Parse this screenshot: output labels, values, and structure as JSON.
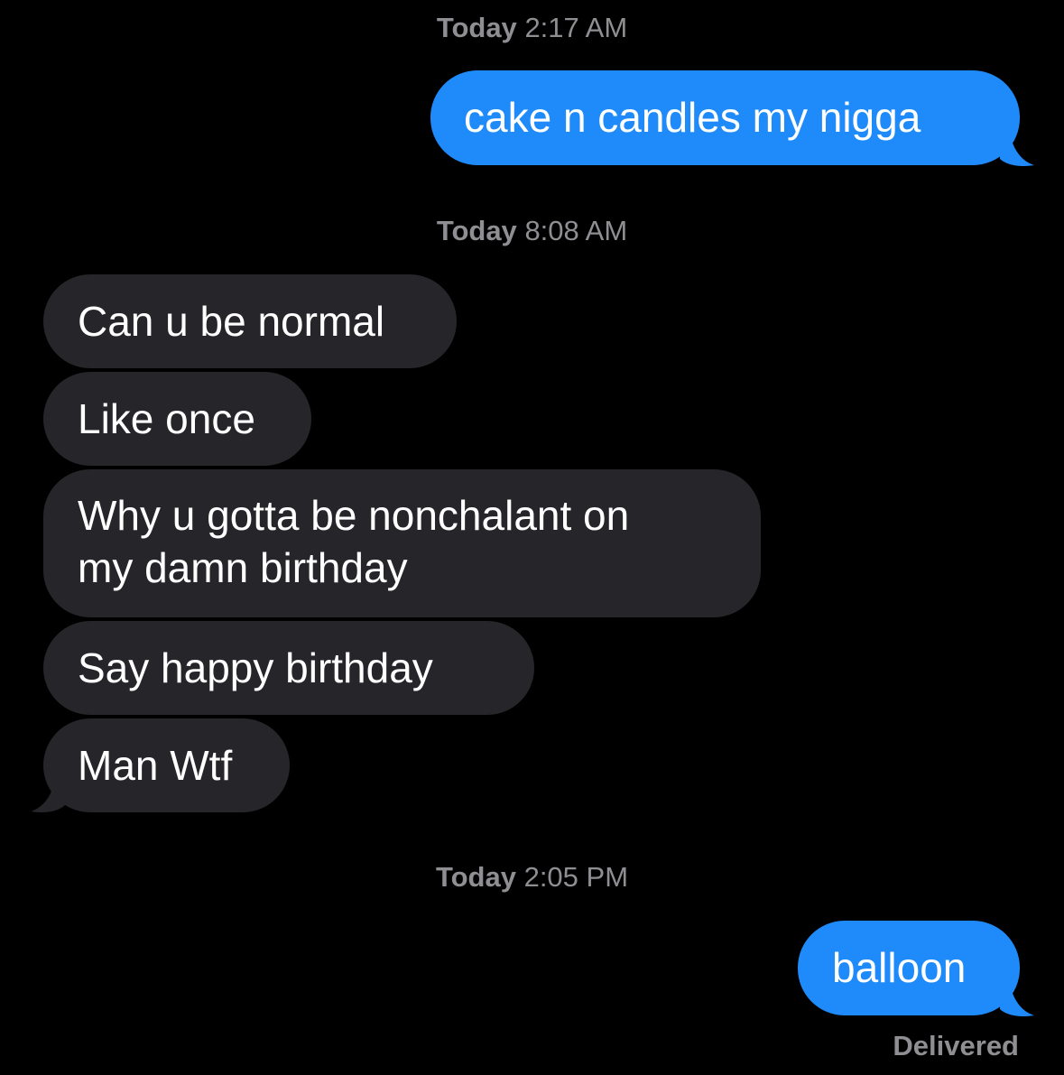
{
  "conversation": {
    "timestamps": [
      {
        "day": "Today",
        "time": "2:17 AM"
      },
      {
        "day": "Today",
        "time": "8:08 AM"
      },
      {
        "day": "Today",
        "time": "2:05 PM"
      }
    ],
    "messages": [
      {
        "direction": "outgoing",
        "text": "cake n candles my nigga"
      },
      {
        "direction": "incoming",
        "text": "Can u be normal"
      },
      {
        "direction": "incoming",
        "text": "Like once"
      },
      {
        "direction": "incoming",
        "lines": [
          "Why u gotta be nonchalant on",
          "my damn birthday"
        ]
      },
      {
        "direction": "incoming",
        "text": "Say happy birthday"
      },
      {
        "direction": "incoming",
        "text": "Man Wtf"
      },
      {
        "direction": "outgoing",
        "text": "balloon"
      }
    ],
    "delivery_status": "Delivered"
  },
  "colors": {
    "background": "#000000",
    "outgoing_bubble": "#1f8bfa",
    "incoming_bubble": "#26252a",
    "text": "#ffffff",
    "meta_text": "#8e8e93"
  }
}
